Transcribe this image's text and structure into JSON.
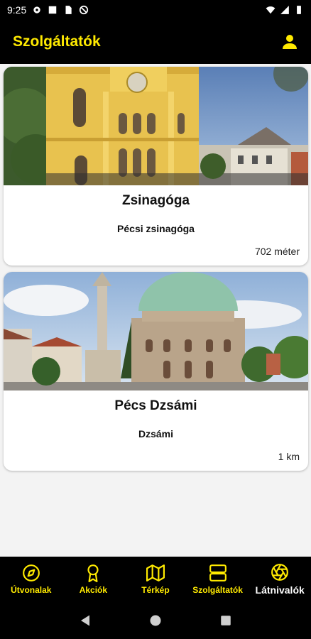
{
  "status_bar": {
    "time": "9:25"
  },
  "app_bar": {
    "title": "Szolgáltatók"
  },
  "cards": [
    {
      "title": "Zsinagóga",
      "subtitle": "Pécsi zsinagóga",
      "distance": "702 méter"
    },
    {
      "title": "Pécs Dzsámi",
      "subtitle": "Dzsámi",
      "distance": "1 km"
    }
  ],
  "bottom_nav": {
    "items": [
      {
        "label": "Útvonalak",
        "icon": "compass-icon"
      },
      {
        "label": "Akciók",
        "icon": "award-icon"
      },
      {
        "label": "Térkép",
        "icon": "map-icon"
      },
      {
        "label": "Szolgáltatók",
        "icon": "services-icon"
      },
      {
        "label": "Látnivalók",
        "icon": "aperture-icon"
      }
    ],
    "active": "Látnivalók"
  },
  "colors": {
    "accent": "#ffea00",
    "bar": "#000000",
    "background": "#f3f3f3"
  }
}
